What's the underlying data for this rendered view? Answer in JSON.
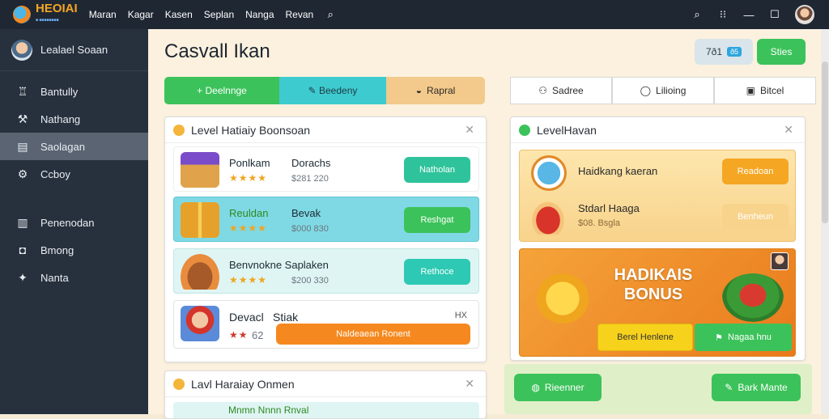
{
  "app": {
    "brand": "HEOIAI",
    "brand_sub": "■ ■■■■■■■■"
  },
  "topnav": [
    "Maran",
    "Kagar",
    "Kasen",
    "Seplan",
    "Nanga",
    "Revan"
  ],
  "sidebar": {
    "user": "Lealael Soaan",
    "items": [
      {
        "label": "Bantully",
        "icon": "tooth-icon"
      },
      {
        "label": "Nathang",
        "icon": "hammer-icon"
      },
      {
        "label": "Saolagan",
        "icon": "folder-icon",
        "active": true
      },
      {
        "label": "Ccboy",
        "icon": "gear-icon"
      },
      {
        "label": "Penenodan",
        "icon": "shop-icon"
      },
      {
        "label": "Bmong",
        "icon": "bag-icon"
      },
      {
        "label": "Nanta",
        "icon": "puzzle-icon"
      }
    ]
  },
  "header": {
    "title": "Casvall Ikan",
    "badge_text": "7ð1",
    "badge_chip": "ð5",
    "button": "Sties"
  },
  "tabs_left": [
    {
      "label": "+ Deelnnge"
    },
    {
      "label": "✎ Beedeny"
    },
    {
      "label": "Rapral"
    }
  ],
  "tabs_right": [
    {
      "label": "Sadree",
      "icon": "person-icon"
    },
    {
      "label": "Lilioing",
      "icon": "chat-icon"
    },
    {
      "label": "Bitcel",
      "icon": "camera-icon"
    }
  ],
  "left_panel": {
    "title": "Level Hatiaiy Boonsoan",
    "rows": [
      {
        "name": "Ponlkam",
        "sub": "Dorachs",
        "stars": "★★★★",
        "price": "$281 220",
        "button": "Natholan"
      },
      {
        "name": "Reuldan",
        "sub": "Bevak",
        "stars": "★★★★",
        "price": "$000 830",
        "button": "Reshgat"
      },
      {
        "name": "Benvnokne Saplaken",
        "sub": "",
        "stars": "★★★★",
        "price": "$200 330",
        "button": "Rethoce"
      },
      {
        "name": "Devacl",
        "sub": "Stiak",
        "stars": "★★",
        "price": "62",
        "button": "Naldeaean Ronent",
        "tag": "HX"
      }
    ]
  },
  "left_panel2": {
    "title": "Lavl Haraiay Onmen",
    "peek": "Mnmn Nnnn Rnval"
  },
  "right_panel": {
    "title": "LevelHavan",
    "item1": {
      "title": "Haidkang kaeran",
      "button": "Readoan"
    },
    "item2": {
      "title": "Stdarl Haaga",
      "price": "$08. Bsgla",
      "button": "Benheun"
    },
    "bonus": {
      "line1": "HADIKAIS",
      "line2": "BONUS",
      "btn_yellow": "Berel Henlene",
      "btn_green": "Nagaa hnu"
    }
  },
  "bottom_buttons": {
    "left": "Rieenner",
    "right": "Bark Mante"
  },
  "colors": {
    "green": "#3cc25a",
    "teal": "#3ecbd0",
    "orange": "#f5891f",
    "sidebar": "#27303d"
  }
}
